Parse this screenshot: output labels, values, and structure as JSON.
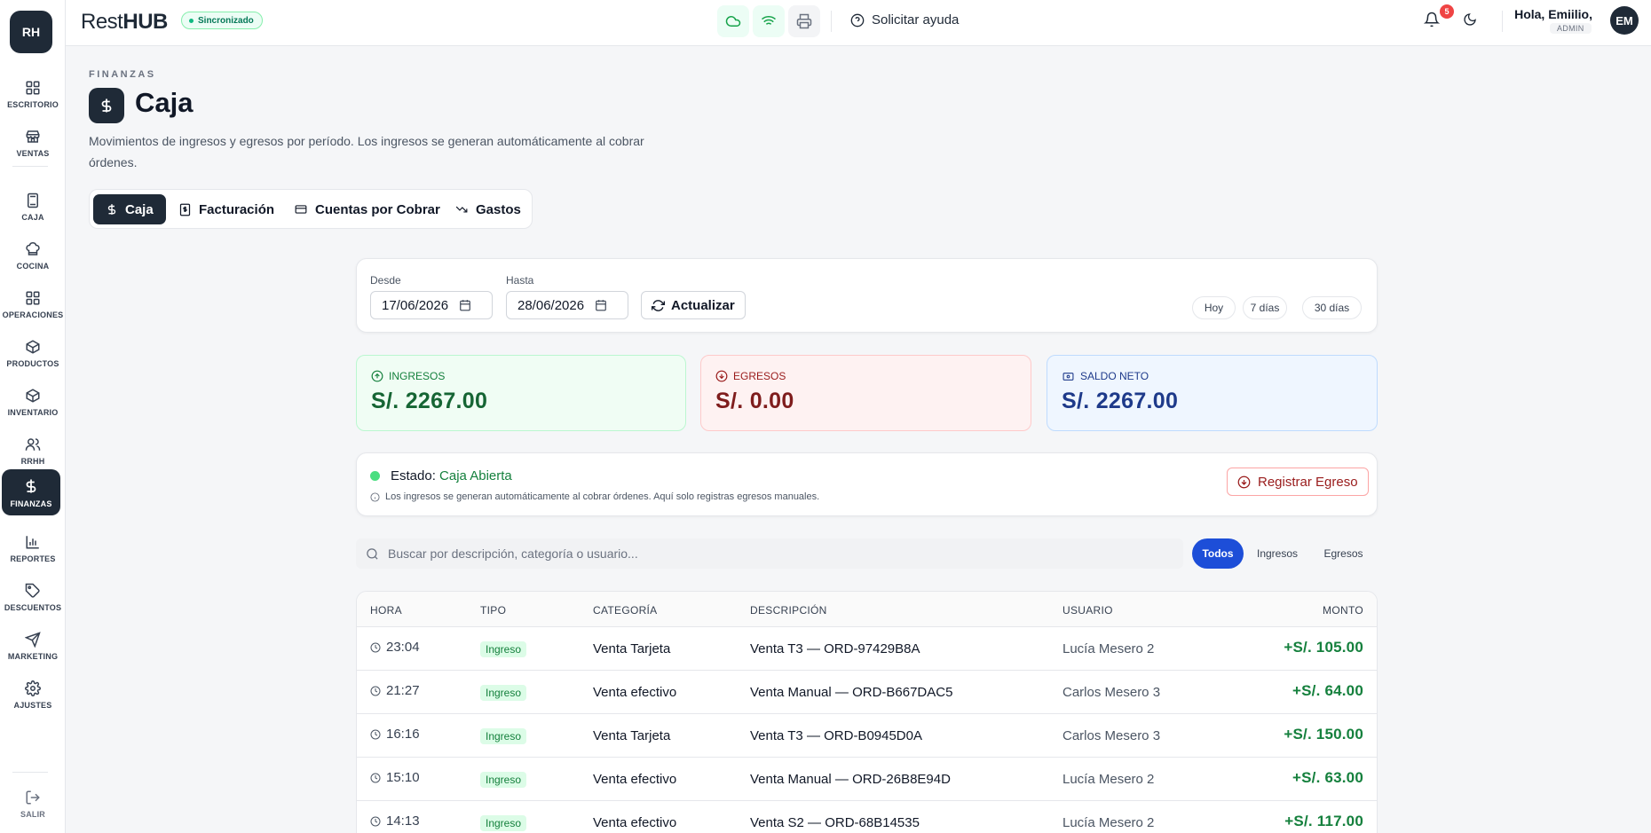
{
  "sidebar": {
    "logo": "RH",
    "items": [
      {
        "label": "ESCRITORIO",
        "icon": "grid-icon"
      },
      {
        "label": "VENTAS",
        "icon": "store-icon"
      },
      {
        "label": "CAJA",
        "icon": "calculator-icon"
      },
      {
        "label": "COCINA",
        "icon": "chef-hat-icon"
      },
      {
        "label": "OPERACIONES",
        "icon": "grid-icon"
      },
      {
        "label": "PRODUCTOS",
        "icon": "box-icon"
      },
      {
        "label": "INVENTARIO",
        "icon": "box-icon"
      },
      {
        "label": "RRHH",
        "icon": "users-icon"
      },
      {
        "label": "FINANZAS",
        "icon": "dollar-icon"
      },
      {
        "label": "REPORTES",
        "icon": "bar-chart-icon"
      },
      {
        "label": "DESCUENTOS",
        "icon": "tag-icon"
      },
      {
        "label": "MARKETING",
        "icon": "send-icon"
      },
      {
        "label": "AJUSTES",
        "icon": "gear-icon"
      }
    ],
    "logout": "SALIR"
  },
  "topbar": {
    "brand_light": "Rest",
    "brand_bold": "HUB",
    "sync_status": "Sincronizado",
    "help": "Solicitar ayuda",
    "notifications": "5",
    "greeting": "Hola, Emiilio,",
    "role": "ADMIN",
    "avatar": "EM"
  },
  "page": {
    "eyebrow": "FINANZAS",
    "title": "Caja",
    "subtitle": "Movimientos de ingresos y egresos por período. Los ingresos se generan automáticamente al cobrar órdenes."
  },
  "tabs": [
    {
      "label": "Caja",
      "active": true
    },
    {
      "label": "Facturación"
    },
    {
      "label": "Cuentas por Cobrar"
    },
    {
      "label": "Gastos"
    }
  ],
  "filters": {
    "from_label": "Desde",
    "from_value": "17/06/2026",
    "to_label": "Hasta",
    "to_value": "28/06/2026",
    "refresh": "Actualizar",
    "presets": [
      "Hoy",
      "7 días",
      "30 días"
    ]
  },
  "stats": {
    "income_label": "INGRESOS",
    "income_value": "S/. 2267.00",
    "expense_label": "EGRESOS",
    "expense_value": "S/. 0.00",
    "net_label": "SALDO NETO",
    "net_value": "S/. 2267.00"
  },
  "status": {
    "label": "Estado:",
    "value": "Caja Abierta",
    "note": "Los ingresos se generan automáticamente al cobrar órdenes. Aquí solo registras egresos manuales.",
    "button": "Registrar Egreso"
  },
  "search": {
    "placeholder": "Buscar por descripción, categoría o usuario..."
  },
  "type_filter": [
    {
      "label": "Todos",
      "active": true
    },
    {
      "label": "Ingresos"
    },
    {
      "label": "Egresos"
    }
  ],
  "table": {
    "headers": [
      "HORA",
      "TIPO",
      "CATEGORÍA",
      "DESCRIPCIÓN",
      "USUARIO",
      "MONTO"
    ],
    "rows": [
      {
        "time": "23:04",
        "type": "Ingreso",
        "category": "Venta Tarjeta",
        "description": "Venta T3 — ORD-97429B8A",
        "user": "Lucía Mesero 2",
        "amount": "+S/. 105.00"
      },
      {
        "time": "21:27",
        "type": "Ingreso",
        "category": "Venta efectivo",
        "description": "Venta Manual — ORD-B667DAC5",
        "user": "Carlos Mesero 3",
        "amount": "+S/. 64.00"
      },
      {
        "time": "16:16",
        "type": "Ingreso",
        "category": "Venta Tarjeta",
        "description": "Venta T3 — ORD-B0945D0A",
        "user": "Carlos Mesero 3",
        "amount": "+S/. 150.00"
      },
      {
        "time": "15:10",
        "type": "Ingreso",
        "category": "Venta efectivo",
        "description": "Venta Manual — ORD-26B8E94D",
        "user": "Lucía Mesero 2",
        "amount": "+S/. 63.00"
      },
      {
        "time": "14:13",
        "type": "Ingreso",
        "category": "Venta efectivo",
        "description": "Venta S2 — ORD-68B14535",
        "user": "Lucía Mesero 2",
        "amount": "+S/. 117.00"
      }
    ]
  },
  "colors": {
    "primary_dark": "#1f2a37",
    "income_green": "#15803d",
    "expense_red": "#991b1b",
    "net_blue": "#1e3a8a",
    "accent_blue": "#1d4ed8"
  }
}
